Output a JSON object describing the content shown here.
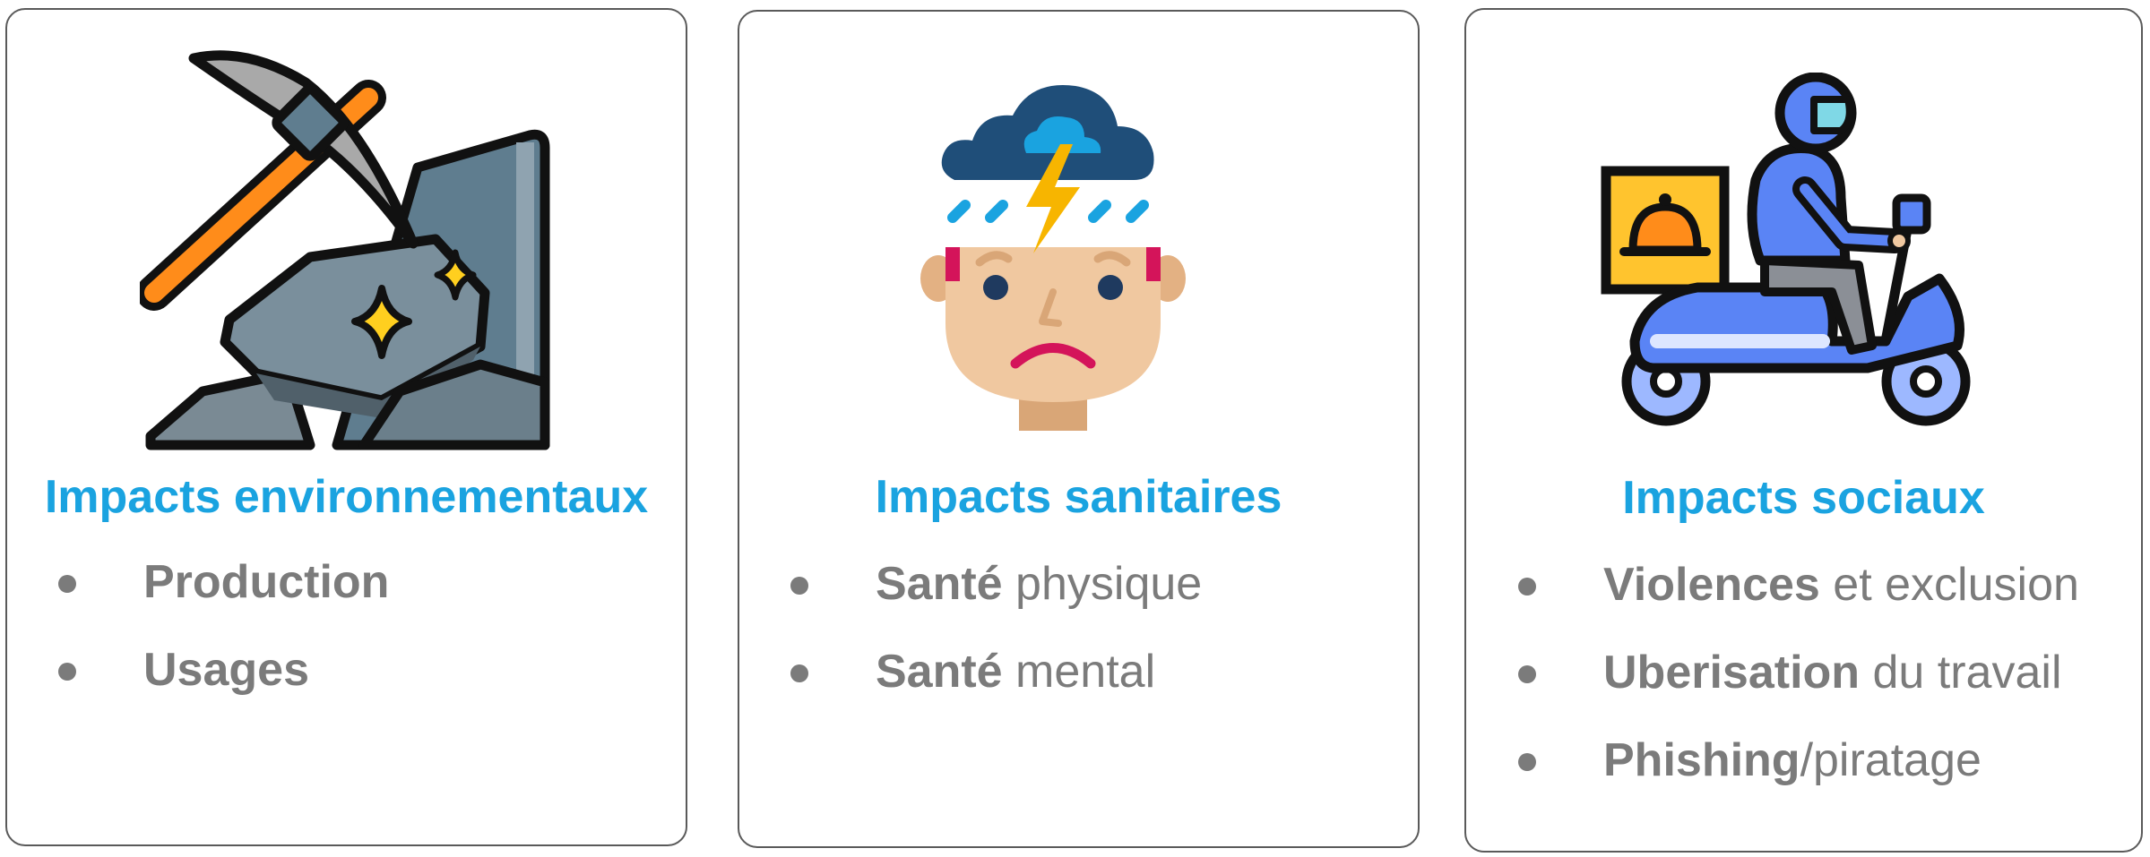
{
  "cards": [
    {
      "icon": "pickaxe-rock-icon",
      "title": "Impacts environnementaux",
      "items": [
        {
          "bold": "Production",
          "rest": ""
        },
        {
          "bold": "Usages",
          "rest": ""
        }
      ]
    },
    {
      "icon": "stressed-head-storm-icon",
      "title": "Impacts sanitaires",
      "items": [
        {
          "bold": "Santé",
          "rest": " physique"
        },
        {
          "bold": "Santé",
          "rest": " mental"
        }
      ]
    },
    {
      "icon": "delivery-scooter-icon",
      "title": "Impacts sociaux",
      "items": [
        {
          "bold": "Violences",
          "rest": " et exclusion"
        },
        {
          "bold": "Uberisation",
          "rest": " du travail"
        },
        {
          "bold": "Phishing",
          "rest": "/piratage"
        }
      ]
    }
  ],
  "colors": {
    "title": "#1aa3e0",
    "text": "#7b7b7b",
    "border": "#5a5a5a"
  }
}
